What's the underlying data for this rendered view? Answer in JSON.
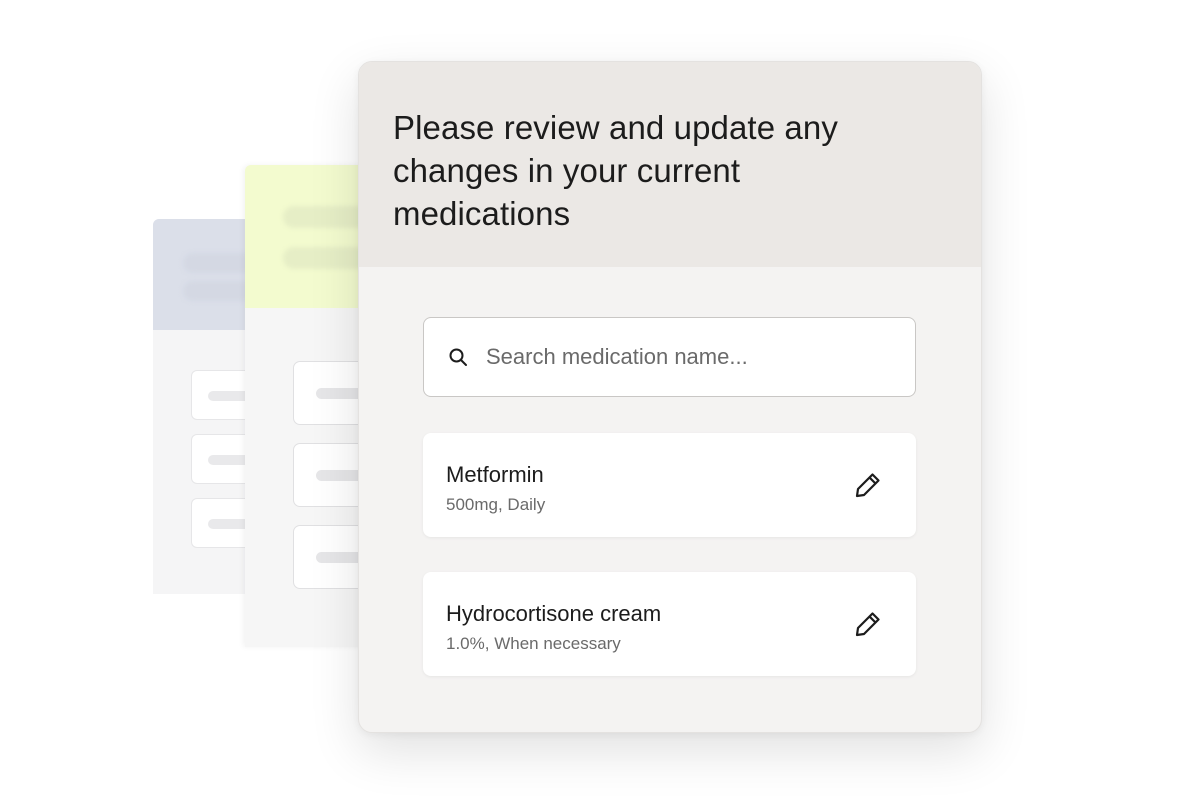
{
  "header": {
    "title": "Please review and update any changes in your current medications"
  },
  "search": {
    "placeholder": "Search medication name...",
    "icon": "search-icon"
  },
  "medications": [
    {
      "name": "Metformin",
      "detail": "500mg, Daily",
      "action_icon": "pencil-icon"
    },
    {
      "name": "Hydrocortisone cream",
      "detail": "1.0%, When necessary",
      "action_icon": "pencil-icon"
    }
  ],
  "colors": {
    "header_bg": "#ebe8e5",
    "card_bg": "#f4f3f2",
    "back_card_accent": "#d5dae6",
    "mid_card_accent": "#f3fbcf",
    "text_primary": "#1c1c1c",
    "text_secondary": "#6a6a6a"
  }
}
